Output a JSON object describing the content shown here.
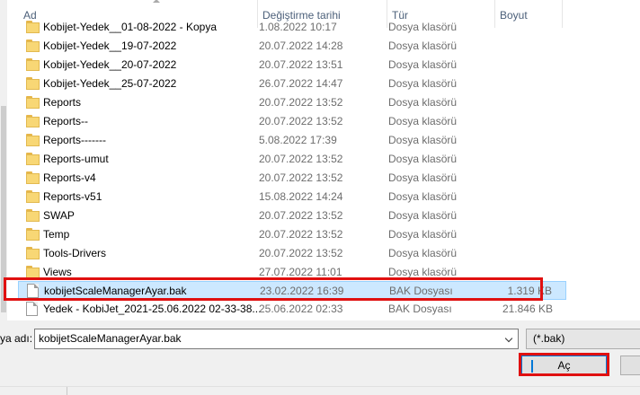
{
  "columns": {
    "name": "Ad",
    "date": "Değiştirme tarihi",
    "type": "Tür",
    "size": "Boyut"
  },
  "files": [
    {
      "name": "Kobijet-Yedek__01-08-2022 - Kopya",
      "date": "1.08.2022 10:17",
      "type": "Dosya klasörü",
      "size": "",
      "icon": "folder-icon"
    },
    {
      "name": "Kobijet-Yedek__19-07-2022",
      "date": "20.07.2022 14:28",
      "type": "Dosya klasörü",
      "size": "",
      "icon": "folder-icon"
    },
    {
      "name": "Kobijet-Yedek__20-07-2022",
      "date": "20.07.2022 13:51",
      "type": "Dosya klasörü",
      "size": "",
      "icon": "folder-icon"
    },
    {
      "name": "Kobijet-Yedek__25-07-2022",
      "date": "26.07.2022 14:47",
      "type": "Dosya klasörü",
      "size": "",
      "icon": "folder-icon"
    },
    {
      "name": "Reports",
      "date": "20.07.2022 13:52",
      "type": "Dosya klasörü",
      "size": "",
      "icon": "folder-icon"
    },
    {
      "name": "Reports--",
      "date": "20.07.2022 13:52",
      "type": "Dosya klasörü",
      "size": "",
      "icon": "folder-icon"
    },
    {
      "name": "Reports-------",
      "date": "5.08.2022 17:39",
      "type": "Dosya klasörü",
      "size": "",
      "icon": "folder-icon"
    },
    {
      "name": "Reports-umut",
      "date": "20.07.2022 13:52",
      "type": "Dosya klasörü",
      "size": "",
      "icon": "folder-icon"
    },
    {
      "name": "Reports-v4",
      "date": "20.07.2022 13:52",
      "type": "Dosya klasörü",
      "size": "",
      "icon": "folder-icon"
    },
    {
      "name": "Reports-v51",
      "date": "15.08.2022 14:24",
      "type": "Dosya klasörü",
      "size": "",
      "icon": "folder-icon"
    },
    {
      "name": "SWAP",
      "date": "20.07.2022 13:52",
      "type": "Dosya klasörü",
      "size": "",
      "icon": "folder-icon"
    },
    {
      "name": "Temp",
      "date": "20.07.2022 13:52",
      "type": "Dosya klasörü",
      "size": "",
      "icon": "folder-icon"
    },
    {
      "name": "Tools-Drivers",
      "date": "20.07.2022 13:52",
      "type": "Dosya klasörü",
      "size": "",
      "icon": "folder-icon"
    },
    {
      "name": "Views",
      "date": "27.07.2022 11:01",
      "type": "Dosya klasörü",
      "size": "",
      "icon": "folder-icon"
    },
    {
      "name": "kobijetScaleManagerAyar.bak",
      "date": "23.02.2022 16:39",
      "type": "BAK Dosyası",
      "size": "1.319 KB",
      "icon": "file-icon",
      "selected": true
    },
    {
      "name": "Yedek - KobiJet_2021-25.06.2022 02-33-38...",
      "date": "25.06.2022 02:33",
      "type": "BAK Dosyası",
      "size": "21.846 KB",
      "icon": "file-icon"
    }
  ],
  "filename_label": "ya adı:",
  "filename_value": "kobijetScaleManagerAyar.bak",
  "filter_value": "(*.bak)",
  "open_button": "Aç",
  "colors": {
    "selection": "#cce8ff",
    "highlight": "#e01010",
    "accent": "#0078d7"
  }
}
